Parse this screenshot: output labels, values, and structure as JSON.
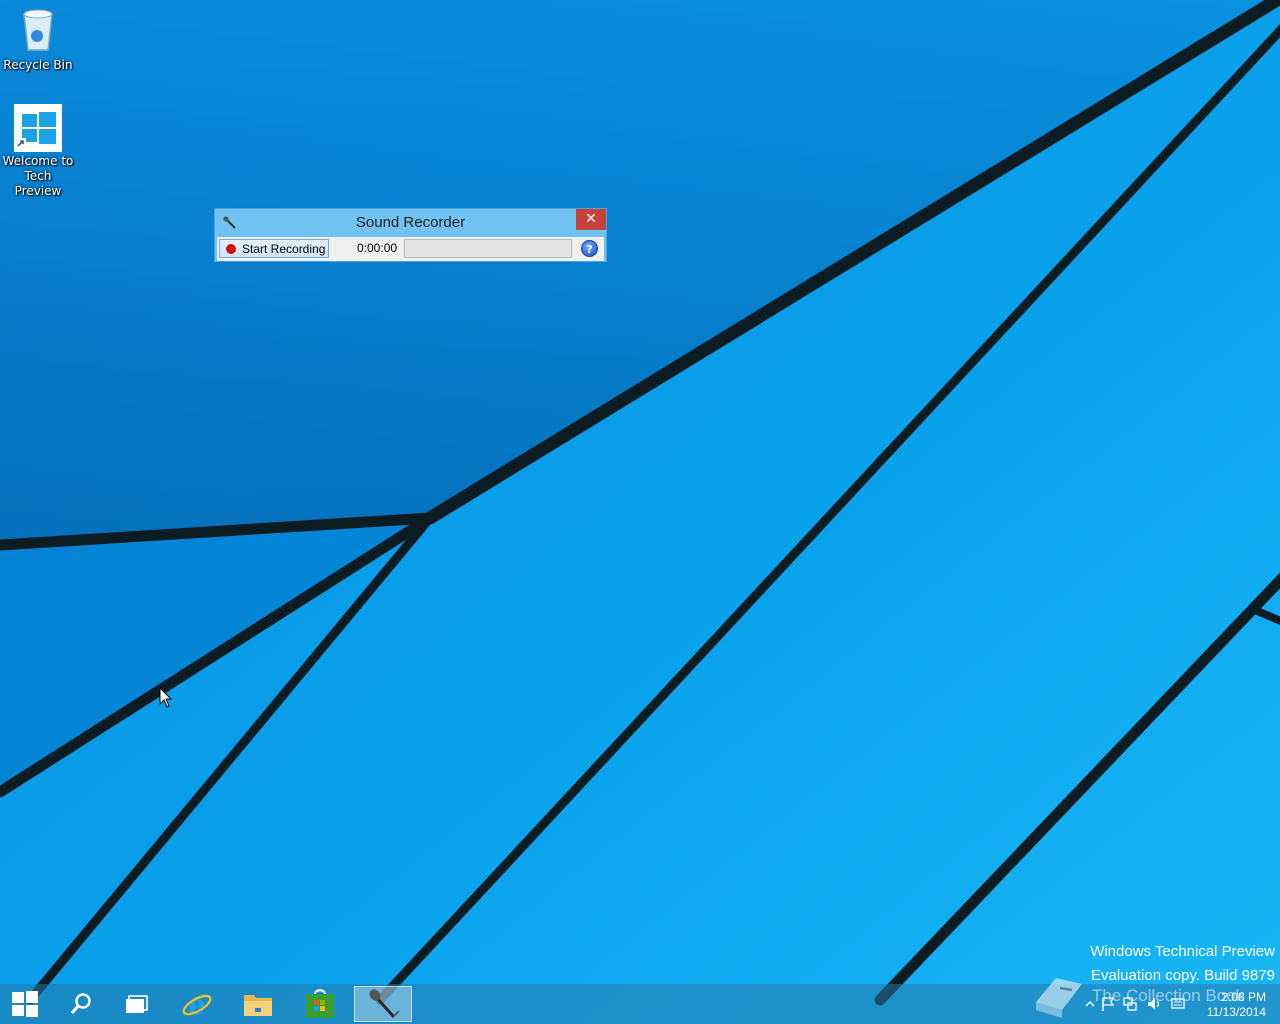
{
  "desktop": {
    "icons": [
      {
        "label": "Recycle Bin",
        "icon": "recycle-bin-icon"
      },
      {
        "label": "Welcome to Tech Preview",
        "icon": "windows-logo-icon"
      }
    ],
    "wallpaper_colors": {
      "dark": "#0066b8",
      "mid": "#0a8fe0",
      "light": "#18b4f5",
      "lines": "#0a1f25"
    }
  },
  "sound_recorder": {
    "title": "Sound Recorder",
    "start_button_label": "Start Recording",
    "elapsed_time": "0:00:00",
    "level_meter_value": 0,
    "close_glyph": "✕",
    "help_glyph": "?",
    "accent_color": "#71c2f0"
  },
  "watermark": {
    "line1": "Windows Technical Preview",
    "line2": "Evaluation copy. Build 9879"
  },
  "taskbar": {
    "buttons": [
      {
        "name": "start",
        "icon": "windows-logo-icon"
      },
      {
        "name": "search",
        "icon": "search-icon"
      },
      {
        "name": "task-view",
        "icon": "task-view-icon"
      },
      {
        "name": "internet-explorer",
        "icon": "internet-explorer-icon"
      },
      {
        "name": "file-explorer",
        "icon": "folder-icon"
      },
      {
        "name": "store",
        "icon": "store-icon"
      },
      {
        "name": "sound-recorder",
        "icon": "microphone-icon",
        "active": true
      }
    ],
    "tray": {
      "icons": [
        "chevron-up-icon",
        "flag-icon",
        "network-icon",
        "volume-icon",
        "action-center-icon"
      ],
      "time": "2:08 PM",
      "date": "11/13/2014"
    }
  },
  "overlay_text": "The Collection Book"
}
